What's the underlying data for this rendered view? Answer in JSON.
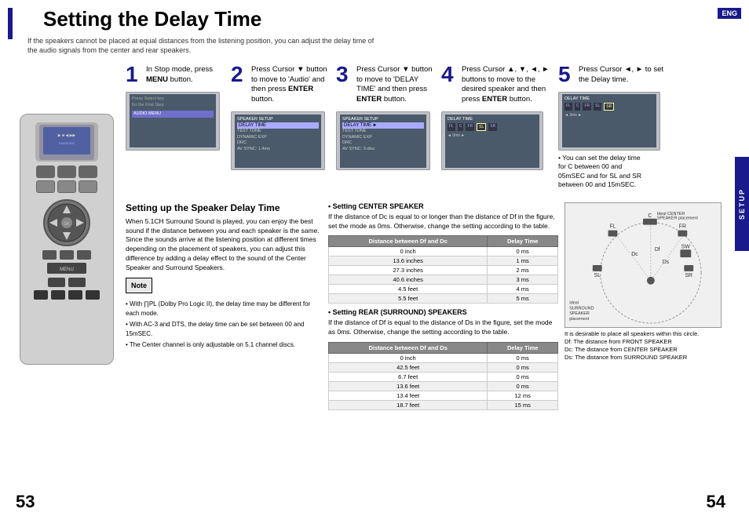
{
  "page": {
    "title": "Setting the Delay Time",
    "subtitle": "If the speakers cannot be placed at equal distances from the listening position, you can adjust the delay time of\nthe audio signals from the center and rear speakers.",
    "eng_badge": "ENG",
    "setup_label": "SETUP",
    "page_left": "53",
    "page_right": "54"
  },
  "steps": [
    {
      "number": "1",
      "text": "In Stop mode, press MENU button.",
      "bold_parts": [
        "MENU"
      ]
    },
    {
      "number": "2",
      "text": "Press Cursor ▼ button to move to 'Audio' and then press ENTER button.",
      "bold_parts": [
        "ENTER"
      ]
    },
    {
      "number": "3",
      "text": "Press Cursor ▼ button to move to 'DELAY TIME' and then press ENTER button.",
      "bold_parts": [
        "ENTER"
      ]
    },
    {
      "number": "4",
      "text": "Press Cursor ▲, ▼, ◄, ► buttons to move to the desired speaker and then press ENTER button.",
      "bold_parts": [
        "ENTER"
      ]
    },
    {
      "number": "5",
      "text": "Press Cursor ◄, ► to set the Delay time.",
      "bold_parts": []
    }
  ],
  "cursor_note": "• You can set the delay time for C between 00 and 05mSEC and for SL and SR between 00 and 15mSEC.",
  "bottom": {
    "section_title": "Setting up the Speaker Delay Time",
    "body_text": "When 5.1CH Surround Sound is played, you can enjoy the best sound if the distance between you and each speaker is the same. Since the sounds arrive at the listening position at different times depending on the placement of speakers, you can adjust this difference by adding a delay effect to the sound of the Center Speaker and Surround Speakers.",
    "note_label": "Note",
    "note_items": [
      "• With ∏PL (Dolby Pro Logic II), the delay time may be different for each mode.",
      "• With AC-3 and DTS, the delay time can be set between 00 and 15mSEC.",
      "• The Center channel is only adjustable on 5.1 channel discs."
    ]
  },
  "center_speaker": {
    "title": "• Setting CENTER SPEAKER",
    "description": "If the distance of Dc is equal to or longer than the distance of Df in the figure, set the mode as 0ms. Otherwise, change the setting according to the table.",
    "table": {
      "headers": [
        "Distance between Df and Dc",
        "Delay Time"
      ],
      "rows": [
        [
          "0 inch",
          "0 ms"
        ],
        [
          "13.6 inches",
          "1 ms"
        ],
        [
          "27.3 inches",
          "2 ms"
        ],
        [
          "40.6 inches",
          "3 ms"
        ],
        [
          "4.5 feet",
          "4 ms"
        ],
        [
          "5.5 feet",
          "5 ms"
        ]
      ]
    }
  },
  "rear_speaker": {
    "title": "• Setting REAR (SURROUND) SPEAKERS",
    "description": "If the distance of Df is equal to the distance of Ds in the figure, set the mode as 0ms. Otherwise, change the setting according to the table.",
    "table": {
      "headers": [
        "Distance between Df and Ds",
        "Delay Time"
      ],
      "rows": [
        [
          "0 inch",
          "0 ms"
        ],
        [
          "42.5 feet",
          "0 ms"
        ],
        [
          "6.7 feet",
          "0 ms"
        ],
        [
          "13.6 feet",
          "0 ms"
        ],
        [
          "13.4 feet",
          "12 ms"
        ],
        [
          "18.7 feet",
          "15 ms"
        ]
      ]
    }
  },
  "diagram": {
    "ideal_center": "Ideal CENTER SPEAKER placement",
    "ideal_surround": "Ideal SURROUND SPEAKER placement",
    "note": "It is desirable to place all speakers within this circle.\nDf: The distance from FRONT SPEAKER\nDc: The distance from CENTER SPEAKER\nDs: The distance from SURROUND SPEAKER"
  }
}
